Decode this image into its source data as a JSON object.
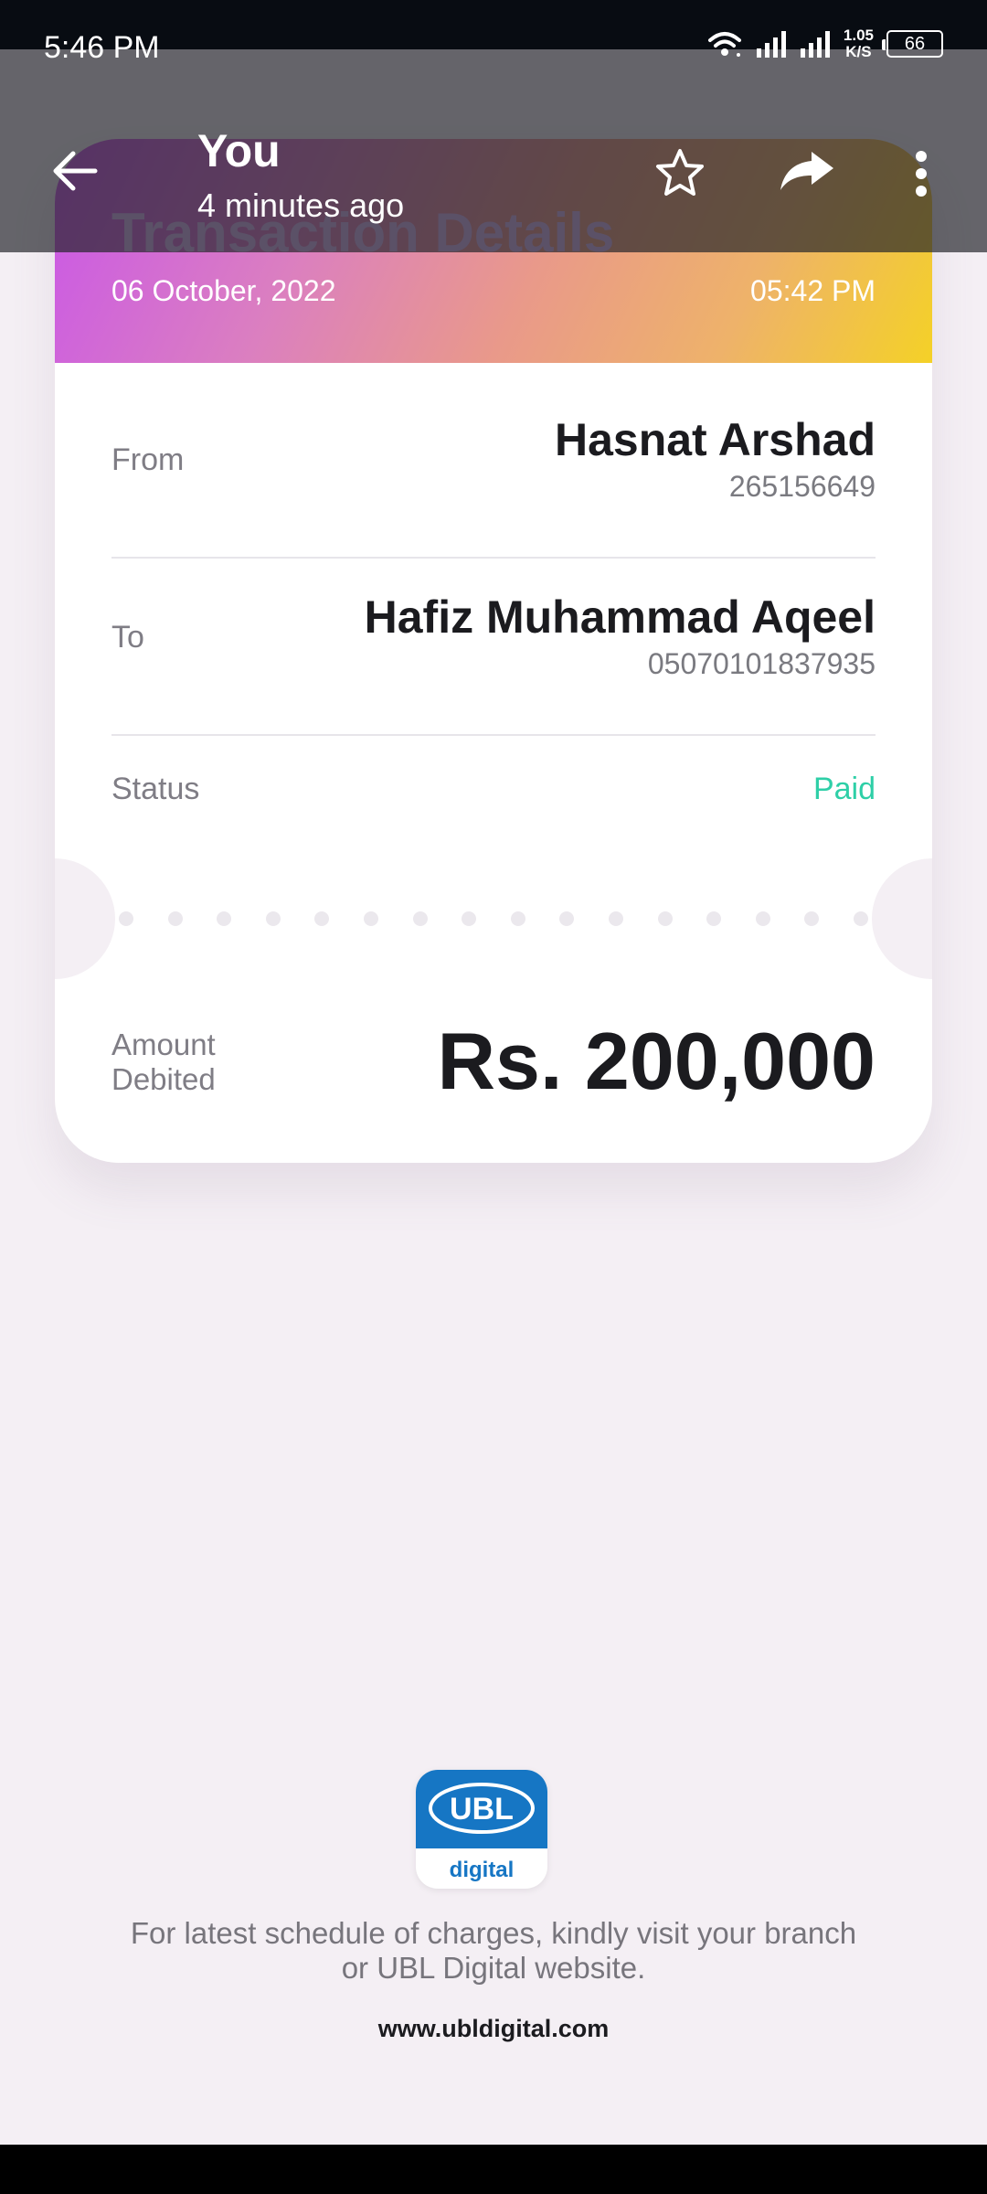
{
  "status_bar": {
    "time": "5:46 PM",
    "net_speed_value": "1.05",
    "net_speed_unit": "K/S",
    "battery": "66",
    "icons": [
      "wifi-icon",
      "signal-icon",
      "signal-icon"
    ]
  },
  "app_bar": {
    "title": "You",
    "subtitle": "4 minutes ago",
    "actions": [
      "back-icon",
      "star-icon",
      "share-icon",
      "more-icon"
    ]
  },
  "receipt": {
    "title": "Transaction Details",
    "date": "06 October, 2022",
    "time": "05:42 PM",
    "from": {
      "label": "From",
      "name": "Hasnat Arshad",
      "account": "265156649"
    },
    "to": {
      "label": "To",
      "name": "Hafiz Muhammad Aqeel",
      "account": "05070101837935"
    },
    "status": {
      "label": "Status",
      "value": "Paid"
    },
    "amount": {
      "label_line1": "Amount",
      "label_line2": "Debited",
      "value": "Rs. 200,000"
    }
  },
  "footer": {
    "logo_text": "UBL",
    "logo_subtext": "digital",
    "note_line1": "For latest schedule of charges, kindly visit your branch",
    "note_line2": "or UBL Digital website.",
    "url": "www.ubldigital.com"
  },
  "colors": {
    "paid": "#2ecfa7",
    "ubl_blue": "#1676c4",
    "gradient": [
      "#c956e8",
      "#e9998a",
      "#f4d127"
    ]
  }
}
